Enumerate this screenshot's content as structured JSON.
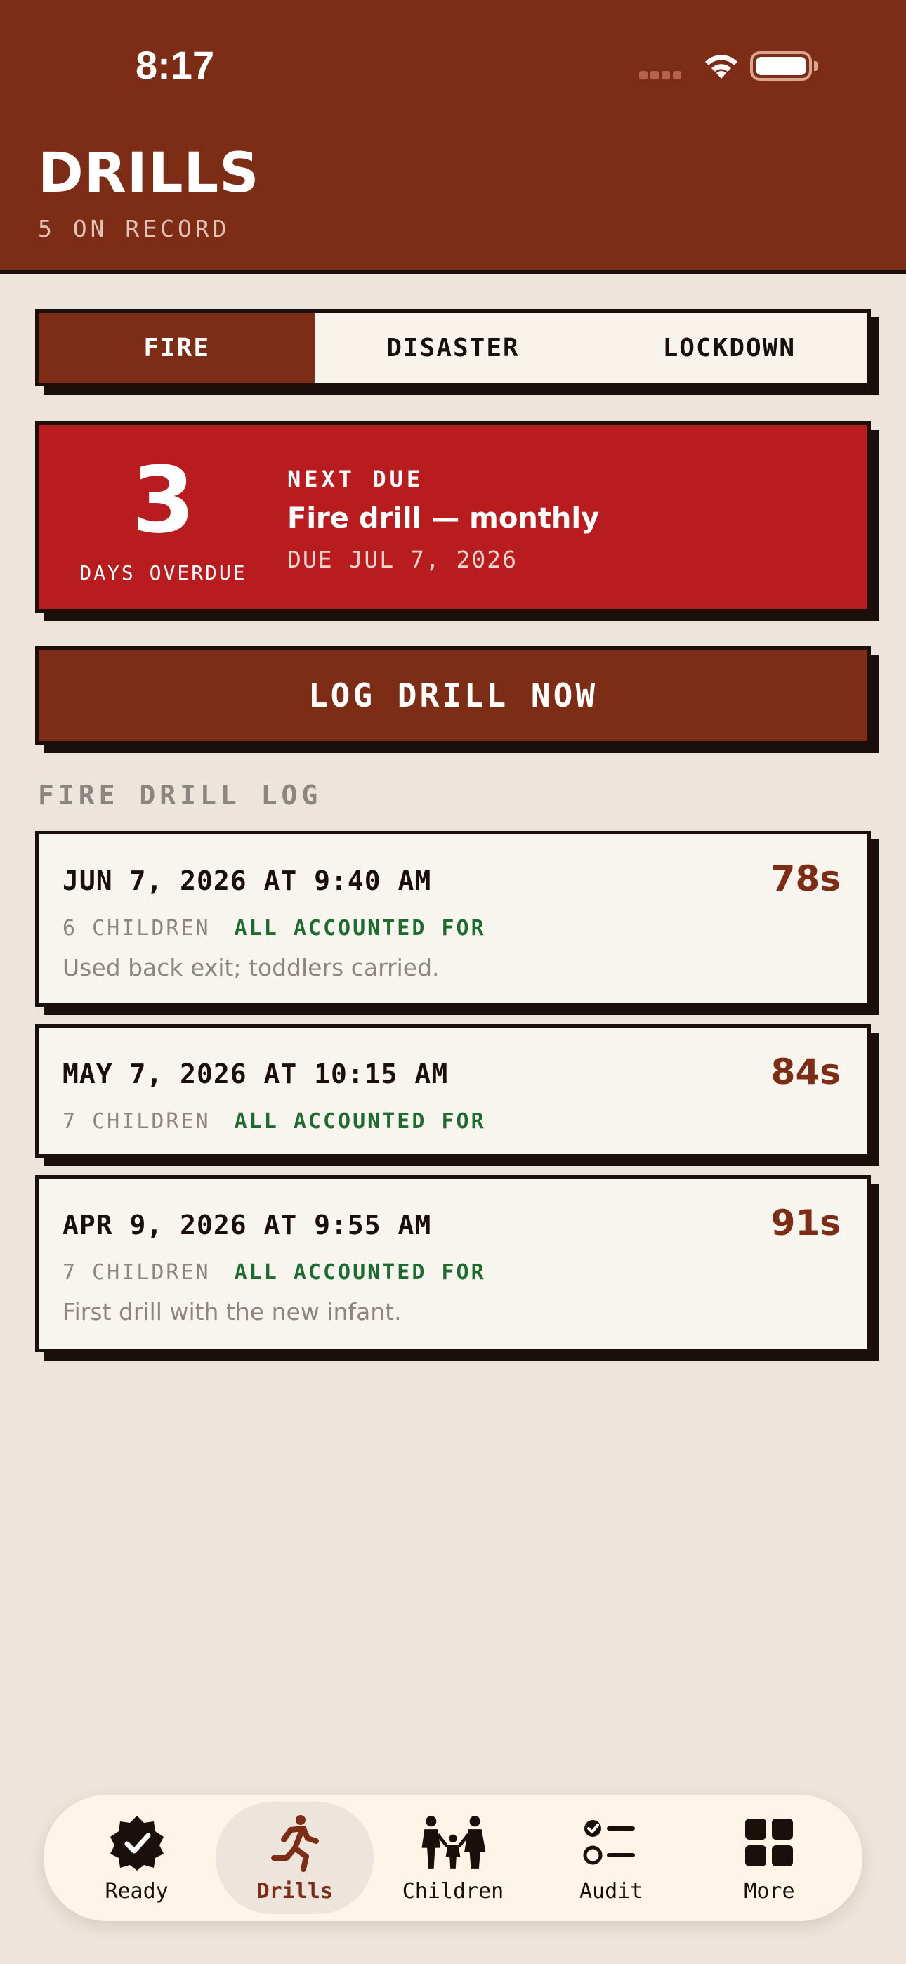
{
  "status_bar": {
    "time": "8:17"
  },
  "header": {
    "title": "DRILLS",
    "subtitle": "5 ON RECORD"
  },
  "segments": [
    {
      "label": "FIRE",
      "active": true
    },
    {
      "label": "DISASTER",
      "active": false
    },
    {
      "label": "LOCKDOWN",
      "active": false
    }
  ],
  "next_due": {
    "days": "3",
    "days_label": "DAYS OVERDUE",
    "kicker": "NEXT DUE",
    "title": "Fire drill — monthly",
    "date": "DUE JUL 7, 2026"
  },
  "log_button": {
    "label": "LOG DRILL NOW"
  },
  "log": {
    "section_label": "FIRE DRILL LOG",
    "entries": [
      {
        "date": "JUN 7, 2026 AT 9:40 AM",
        "duration": "78s",
        "children": "6 CHILDREN",
        "status": "ALL ACCOUNTED FOR",
        "note": "Used back exit; toddlers carried."
      },
      {
        "date": "MAY 7, 2026 AT 10:15 AM",
        "duration": "84s",
        "children": "7 CHILDREN",
        "status": "ALL ACCOUNTED FOR",
        "note": ""
      },
      {
        "date": "APR 9, 2026 AT 9:55 AM",
        "duration": "91s",
        "children": "7 CHILDREN",
        "status": "ALL ACCOUNTED FOR",
        "note": "First drill with the new infant."
      }
    ]
  },
  "tabbar": {
    "items": [
      {
        "label": "Ready",
        "icon": "verified-badge-icon",
        "active": false
      },
      {
        "label": "Drills",
        "icon": "running-person-icon",
        "active": true
      },
      {
        "label": "Children",
        "icon": "family-icon",
        "active": false
      },
      {
        "label": "Audit",
        "icon": "checklist-icon",
        "active": false
      },
      {
        "label": "More",
        "icon": "grid-icon",
        "active": false
      }
    ]
  },
  "colors": {
    "header_bg": "#7d2d15",
    "overdue_bg": "#b81c1f",
    "accent": "#7d2d15",
    "success": "#1d6b30",
    "page_bg": "#ede5dc"
  }
}
